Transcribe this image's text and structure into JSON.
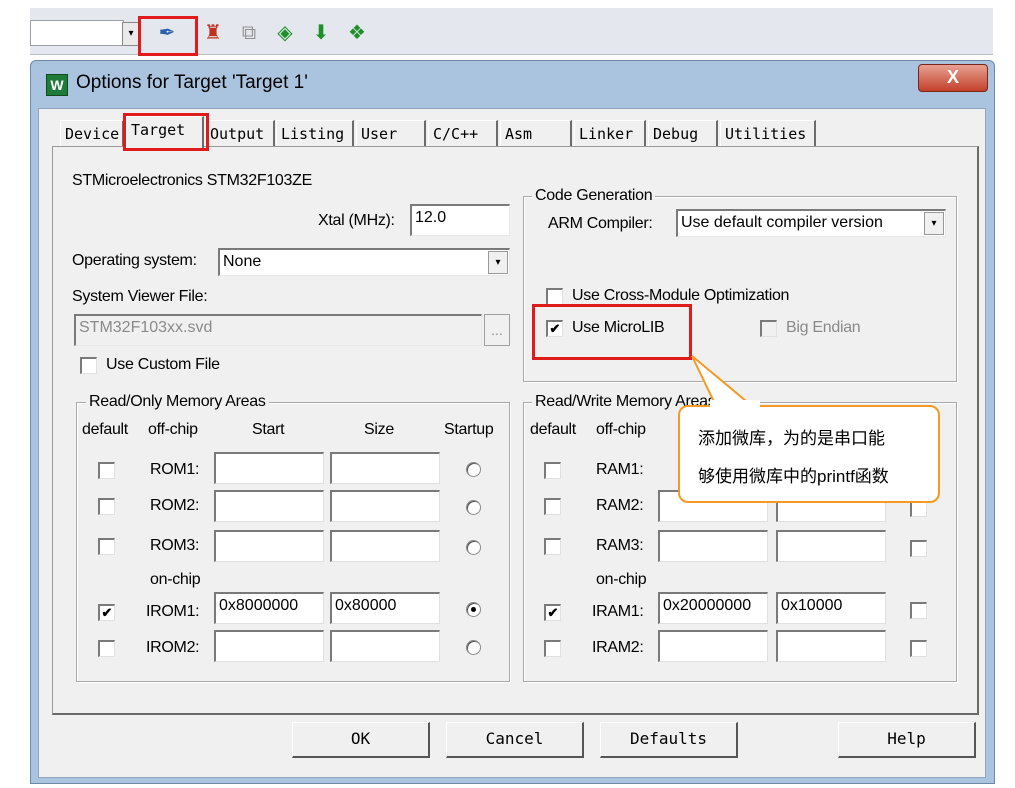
{
  "window": {
    "title": "Options for Target 'Target 1'",
    "close_label": "X",
    "app_icon_label": "W"
  },
  "tabs": [
    "Device",
    "Target",
    "Output",
    "Listing",
    "User",
    "C/C++",
    "Asm",
    "Linker",
    "Debug",
    "Utilities"
  ],
  "device_name": "STMicroelectronics STM32F103ZE",
  "xtal": {
    "label": "Xtal (MHz):",
    "value": "12.0"
  },
  "operating_system": {
    "label": "Operating system:",
    "value": "None"
  },
  "system_viewer": {
    "label": "System Viewer File:",
    "value": "STM32F103xx.svd",
    "browse_label": "...",
    "use_custom_label": "Use Custom File"
  },
  "code_generation": {
    "legend": "Code Generation",
    "compiler_label": "ARM Compiler:",
    "compiler_value": "Use default compiler version",
    "cross_module_label": "Use Cross-Module Optimization",
    "microlib_label": "Use MicroLIB",
    "microlib_checked": true,
    "big_endian_label": "Big Endian"
  },
  "ro_memory": {
    "legend": "Read/Only Memory Areas",
    "headers": {
      "default": "default",
      "offchip": "off-chip",
      "start": "Start",
      "size": "Size",
      "startup": "Startup"
    },
    "onchip_label": "on-chip",
    "rows": [
      {
        "name": "ROM1:",
        "start": "",
        "size": "",
        "checked": false,
        "startup": false
      },
      {
        "name": "ROM2:",
        "start": "",
        "size": "",
        "checked": false,
        "startup": false
      },
      {
        "name": "ROM3:",
        "start": "",
        "size": "",
        "checked": false,
        "startup": false
      },
      {
        "name": "IROM1:",
        "start": "0x8000000",
        "size": "0x80000",
        "checked": true,
        "startup": true
      },
      {
        "name": "IROM2:",
        "start": "",
        "size": "",
        "checked": false,
        "startup": false
      }
    ]
  },
  "rw_memory": {
    "legend": "Read/Write Memory Areas",
    "headers": {
      "default": "default",
      "offchip": "off-chip"
    },
    "onchip_label": "on-chip",
    "rows": [
      {
        "name": "RAM1:",
        "start": "",
        "size": "",
        "checked": false
      },
      {
        "name": "RAM2:",
        "start": "",
        "size": "",
        "checked": false
      },
      {
        "name": "RAM3:",
        "start": "",
        "size": "",
        "checked": false
      },
      {
        "name": "IRAM1:",
        "start": "0x20000000",
        "size": "0x10000",
        "checked": true
      },
      {
        "name": "IRAM2:",
        "start": "",
        "size": "",
        "checked": false
      }
    ]
  },
  "callout": {
    "line1": "添加微库，为的是串口能",
    "line2": "够使用微库中的printf函数"
  },
  "buttons": {
    "ok": "OK",
    "cancel": "Cancel",
    "defaults": "Defaults",
    "help": "Help"
  },
  "checkmark": "✔",
  "toolbar": {
    "dropdown_icon": "▾",
    "icons": [
      "wand-icon",
      "load-icon",
      "copy-icon",
      "diamond-icon",
      "download-icon",
      "gear-cube-icon"
    ],
    "glyphs": [
      "✒",
      "♜",
      "⧉",
      "◈",
      "⬇",
      "❖"
    ],
    "colors": [
      "#2a5fae",
      "#c03020",
      "#909090",
      "#1f8f2a",
      "#1f8f2a",
      "#1f8f2a"
    ]
  },
  "colors": {
    "annotation_red": "#e11b1b",
    "callout_orange": "#f59a22"
  }
}
